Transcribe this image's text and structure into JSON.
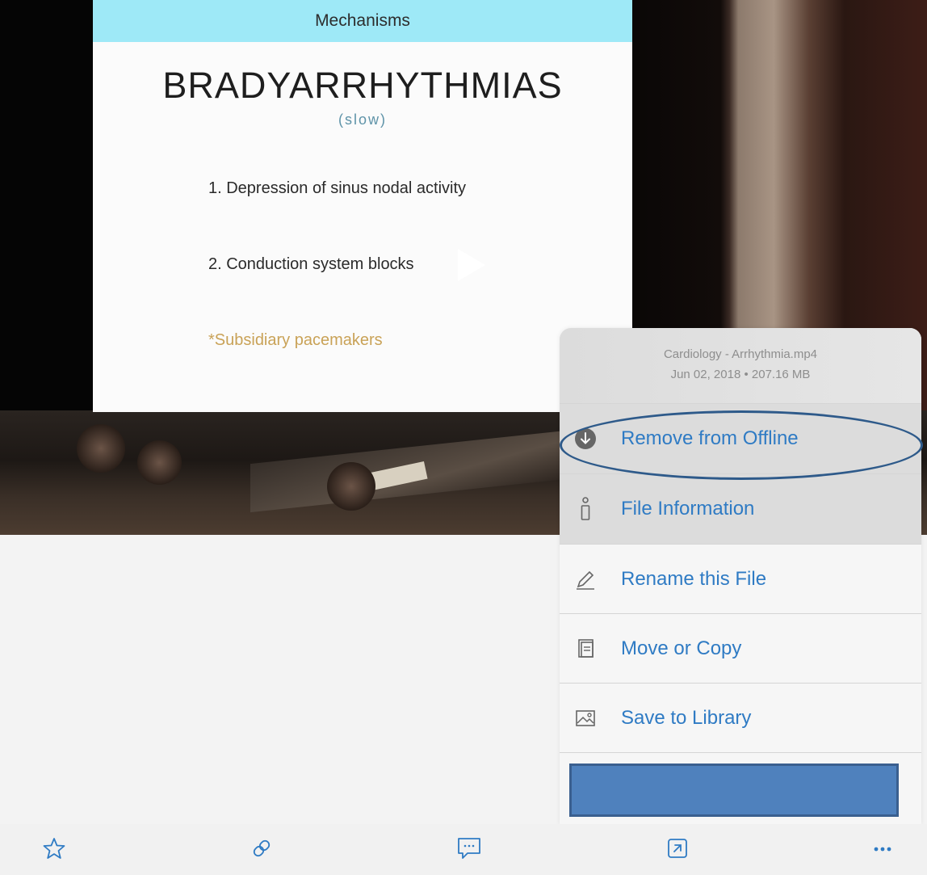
{
  "slide": {
    "header": "Mechanisms",
    "title": "BRADYARRHYTHMIAS",
    "subtitle": "(slow)",
    "items": [
      "1. Depression of sinus nodal activity",
      "2. Conduction system blocks"
    ],
    "note": "*Subsidiary pacemakers"
  },
  "player": {
    "play_icon": "play-triangle-icon"
  },
  "action_sheet": {
    "file_name": "Cardiology - Arrhythmia.mp4",
    "file_meta": "Jun 02, 2018 • 207.16 MB",
    "items": [
      {
        "label": "Remove from Offline",
        "icon": "download-circle-icon",
        "highlighted": true
      },
      {
        "label": "File Information",
        "icon": "info-icon"
      },
      {
        "label": "Rename this File",
        "icon": "pencil-icon"
      },
      {
        "label": "Move or Copy",
        "icon": "copy-icon"
      },
      {
        "label": "Save to Library",
        "icon": "image-icon"
      }
    ]
  },
  "toolbar": {
    "buttons": [
      {
        "icon": "star-icon"
      },
      {
        "icon": "link-icon"
      },
      {
        "icon": "comment-icon"
      },
      {
        "icon": "open-external-icon"
      },
      {
        "icon": "more-icon"
      }
    ]
  },
  "colors": {
    "accent": "#2f7bc4",
    "slide_header": "#9ee9f7",
    "annotation": "#2e5a8a",
    "cover_box": "#4f81bd"
  }
}
